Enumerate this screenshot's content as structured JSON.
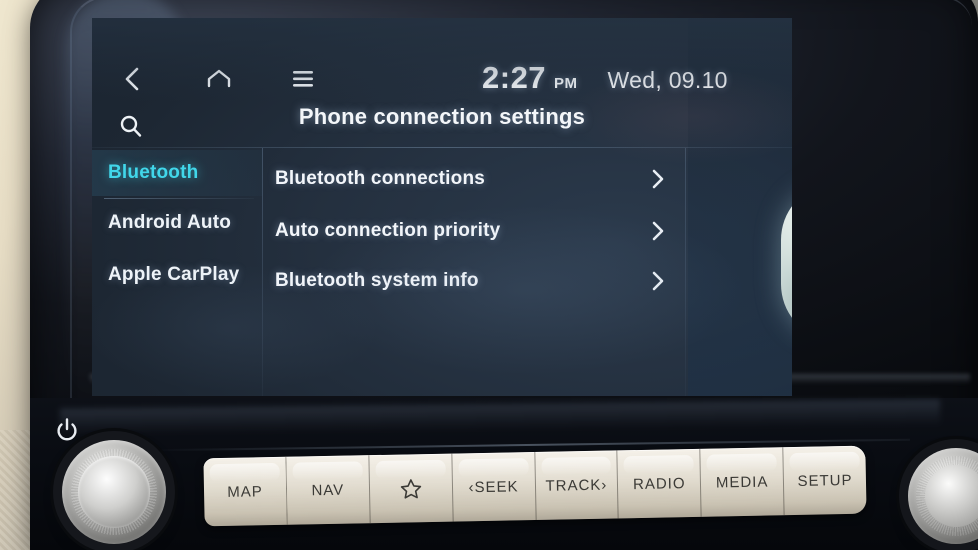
{
  "device": {
    "type": "car-infotainment-head-unit",
    "brand_accent": "#41d7ea"
  },
  "status_bar": {
    "back_icon": "chevron-left-icon",
    "home_icon": "home-icon",
    "menu_icon": "hamburger-menu-icon",
    "search_icon": "search-icon",
    "time": "2:27",
    "am_pm": "PM",
    "date": "Wed, 09.10"
  },
  "header": {
    "title": "Phone connection settings"
  },
  "sidebar": {
    "items": [
      {
        "label": "Bluetooth",
        "active": true
      },
      {
        "label": "Android Auto",
        "active": false
      },
      {
        "label": "Apple CarPlay",
        "active": false
      }
    ]
  },
  "main": {
    "rows": [
      {
        "label": "Bluetooth connections",
        "chevron": "chevron-right-icon"
      },
      {
        "label": "Auto connection priority",
        "chevron": "chevron-right-icon"
      },
      {
        "label": "Bluetooth system info",
        "chevron": "chevron-right-icon"
      }
    ]
  },
  "illustration": {
    "icon": "bluetooth-logo-icon",
    "color": "#dbe7e3"
  },
  "hardware": {
    "power_icon": "power-icon",
    "left_knob": "volume-power-knob",
    "right_knob": "tune-knob",
    "buttons": [
      {
        "label": "MAP",
        "icon": ""
      },
      {
        "label": "NAV",
        "icon": ""
      },
      {
        "label": "",
        "icon": "star-icon"
      },
      {
        "label": "‹SEEK",
        "icon": ""
      },
      {
        "label": "TRACK›",
        "icon": ""
      },
      {
        "label": "RADIO",
        "icon": ""
      },
      {
        "label": "MEDIA",
        "icon": ""
      },
      {
        "label": "SETUP",
        "icon": ""
      }
    ]
  }
}
